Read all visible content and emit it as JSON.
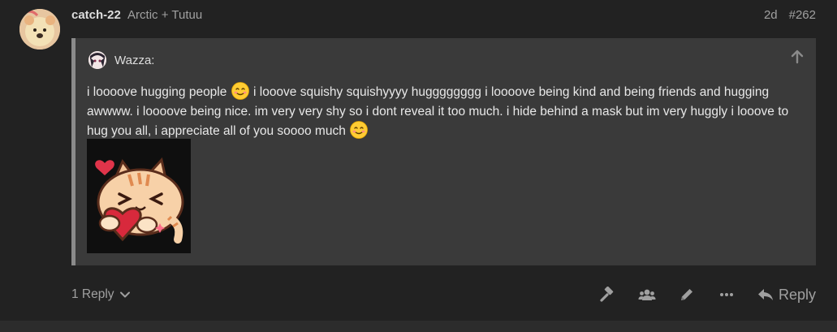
{
  "post": {
    "username": "catch-22",
    "full_name": "Arctic + Tutuu",
    "age": "2d",
    "post_number": "#262",
    "avatar_icon": "user-avatar-plush",
    "quote": {
      "author": "Wazza:",
      "author_avatar_icon": "user-avatar-anime",
      "text_parts": [
        "i loooove hugging people",
        "i looove squishy squishyyyy hugggggggg i loooove being kind and being friends and hugging awwww. i loooove being nice. im very very shy so i dont reveal it too much. i hide behind a mask but im very huggly i looove to hug you all, i appreciate all of you soooo much"
      ],
      "emoji_icon": "smiling-face-emoji",
      "sticker_icon": "cat-hugging-heart-sticker"
    },
    "replies_label": "1 Reply",
    "reply_label": "Reply",
    "action_icons": [
      "hammer-icon",
      "group-icon",
      "pencil-icon",
      "more-icon",
      "reply-arrow-icon"
    ]
  },
  "colors": {
    "background": "#222222",
    "quote_bg": "#3a3a3a",
    "quote_border": "#8a8a8a",
    "text": "#dddddd",
    "muted": "#a0a0a0"
  }
}
